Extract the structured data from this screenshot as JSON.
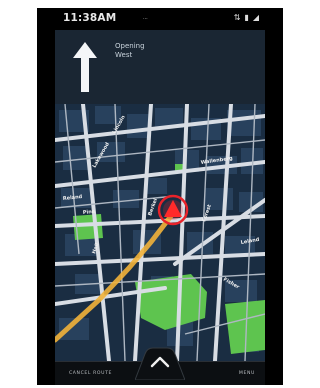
{
  "status_bar": {
    "time": "11:38AM",
    "center": "...",
    "icons": [
      "sync-icon",
      "battery-icon",
      "signal-icon"
    ]
  },
  "direction": {
    "instruction": "Opening",
    "street": "West",
    "arrow": "straight-up-arrow-icon"
  },
  "map": {
    "labels": [
      "Lincoln",
      "Wallenberg",
      "Lakewood",
      "Reland",
      "Pine",
      "Berkel",
      "Forest",
      "Hall",
      "Fisher",
      "Leland"
    ],
    "location_marker": "current-location-icon",
    "colors": {
      "road": "#d8dde4",
      "route": "#f2b23a",
      "park": "#5ec44f",
      "block": "#243a52",
      "water": "#0f1c2a",
      "marker": "#e8232a"
    }
  },
  "bottom_bar": {
    "cancel_label": "CANCEL ROUTE",
    "menu_label": "MENU"
  }
}
